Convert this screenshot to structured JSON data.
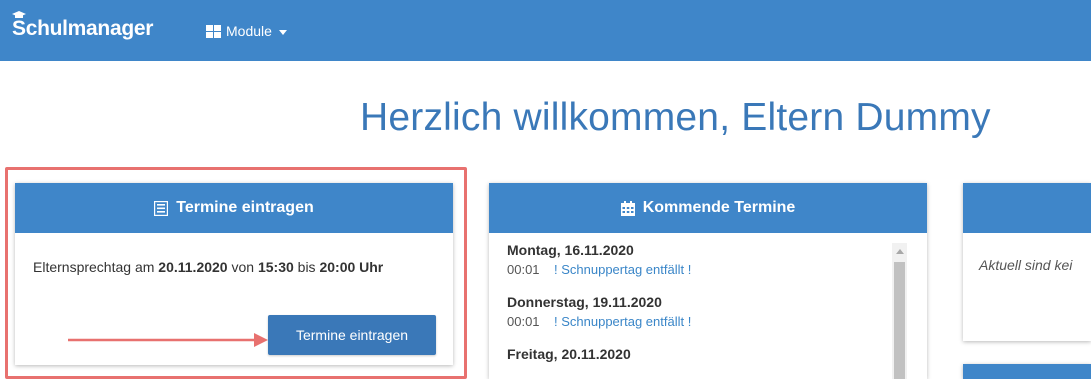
{
  "navbar": {
    "brand": "Schulmanager",
    "modules_label": "Module"
  },
  "welcome": "Herzlich willkommen, Eltern Dummy",
  "panels": {
    "enter": {
      "title": "Termine eintragen",
      "text_prefix": "Elternsprechtag am ",
      "date": "20.11.2020",
      "text_from": " von ",
      "time_from": "15:30",
      "text_to": " bis ",
      "time_to": "20:00 Uhr",
      "button_label": "Termine eintragen"
    },
    "upcoming": {
      "title": "Kommende Termine",
      "events": [
        {
          "day": "Montag, 16.11.2020",
          "time": "00:01",
          "title": "! Schnuppertag entfällt !"
        },
        {
          "day": "Donnerstag, 19.11.2020",
          "time": "00:01",
          "title": "! Schnuppertag entfällt !"
        },
        {
          "day": "Freitag, 20.11.2020"
        }
      ]
    },
    "third": {
      "text": "Aktuell sind kei"
    }
  },
  "colors": {
    "primary": "#3f86c9",
    "button": "#3a78b8",
    "highlight": "#e8716f",
    "link": "#3a86c8"
  }
}
